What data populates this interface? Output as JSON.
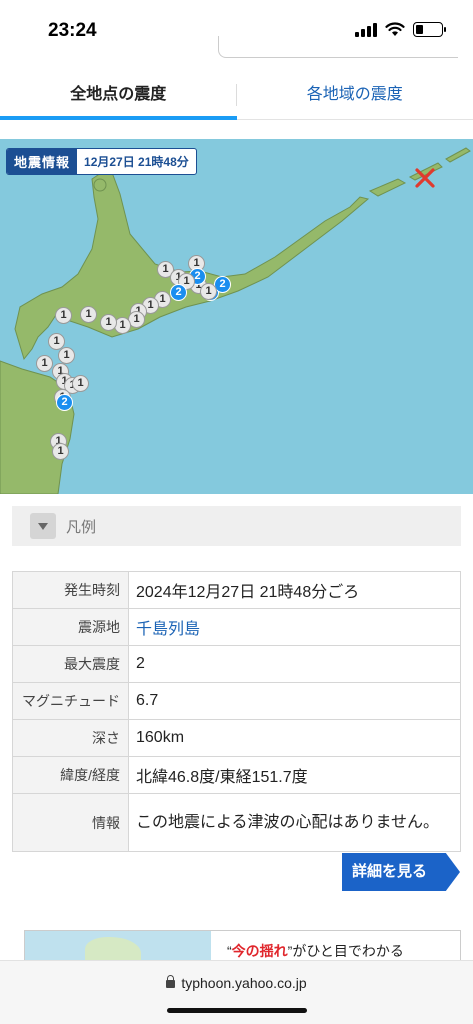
{
  "status_bar": {
    "time": "23:24",
    "battery_level": 0.3
  },
  "tabs": [
    {
      "label": "全地点の震度",
      "active": true
    },
    {
      "label": "各地域の震度",
      "active": false
    }
  ],
  "map": {
    "header_label": "地震情報",
    "header_time": "12月27日 21時48分",
    "epicenter_icon": "cross-icon",
    "colors": {
      "sea": "#84c9dd",
      "land": "#95b96a",
      "intensity1": "#e8e8e8",
      "intensity2": "#1a8ef0"
    },
    "markers": [
      {
        "value": "1"
      },
      {
        "value": "1"
      },
      {
        "value": "1"
      },
      {
        "value": "1"
      },
      {
        "value": "2"
      },
      {
        "value": "1"
      },
      {
        "value": "2"
      },
      {
        "value": "2"
      },
      {
        "value": "2"
      },
      {
        "value": "1"
      },
      {
        "value": "1"
      },
      {
        "value": "1"
      },
      {
        "value": "1"
      },
      {
        "value": "1"
      },
      {
        "value": "1"
      },
      {
        "value": "1"
      },
      {
        "value": "1"
      },
      {
        "value": "1"
      },
      {
        "value": "1"
      },
      {
        "value": "1"
      },
      {
        "value": "1"
      },
      {
        "value": "1"
      },
      {
        "value": "1"
      },
      {
        "value": "1"
      },
      {
        "value": "1"
      },
      {
        "value": "1"
      },
      {
        "value": "2"
      },
      {
        "value": "1"
      },
      {
        "value": "1"
      }
    ]
  },
  "legend": {
    "label": "凡例"
  },
  "info": {
    "rows": [
      {
        "label": "発生時刻",
        "value": "2024年12月27日 21時48分ごろ"
      },
      {
        "label": "震源地",
        "value": "千島列島"
      },
      {
        "label": "最大震度",
        "value": "2"
      },
      {
        "label": "マグニチュード",
        "value": "6.7"
      },
      {
        "label": "深さ",
        "value": "160km"
      },
      {
        "label": "緯度/経度",
        "value": "北緯46.8度/東経151.7度"
      },
      {
        "label": "情報",
        "value": "この地震による津波の心配はありません。"
      }
    ]
  },
  "detail_button": {
    "label": "詳細を見る"
  },
  "banner": {
    "quote_open": "“",
    "highlight": "今の揺れ",
    "quote_close": "”",
    "text": "がひと目でわかる"
  },
  "browser": {
    "url": "typhoon.yahoo.co.jp"
  }
}
